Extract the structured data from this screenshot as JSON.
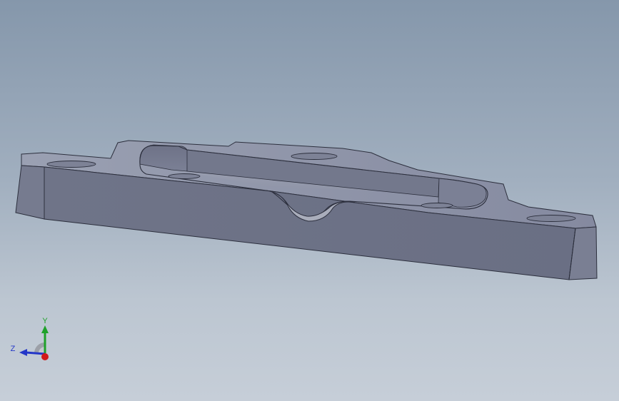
{
  "viewport": {
    "model": "plate-bracket-part",
    "background_top": "#8597ab",
    "background_bottom": "#c6ced8"
  },
  "triad": {
    "x_label": "",
    "y_label": "Y",
    "z_label": "Z",
    "y_color": "#1fa12a",
    "z_color": "#2437c8",
    "x_color": "#d21a1a"
  }
}
